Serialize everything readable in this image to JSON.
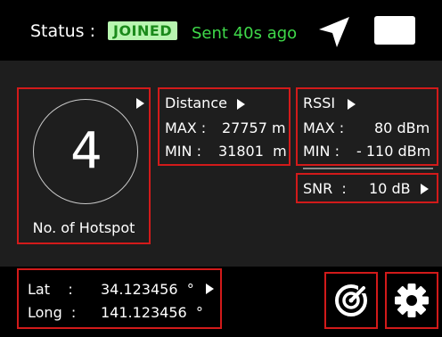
{
  "header": {
    "status_label": "Status :",
    "status_badge": "JOINED",
    "sent_text": "Sent 40s ago",
    "icons": [
      "navigation-arrow-icon",
      "battery-icon"
    ]
  },
  "hotspot": {
    "count": "4",
    "label": "No. of Hotspot"
  },
  "distance": {
    "title": "Distance",
    "max_label": "MAX :",
    "max_value": "27757 m",
    "min_label": "MIN : ",
    "min_value": "31801  m"
  },
  "rssi": {
    "title": "RSSI",
    "max_label": "MAX :",
    "max_value": "80 dBm",
    "min_label": "MIN :",
    "min_value": "- 110 dBm"
  },
  "snr": {
    "label": "SNR  :",
    "value": "10 dB"
  },
  "location": {
    "lat_label": "Lat    :",
    "lat_value": "34.123456  °",
    "long_label": "Long  :",
    "long_value": "141.123456  °"
  },
  "colors": {
    "highlight_border": "#d21a1a",
    "joined_bg": "#b8f5b0",
    "joined_text": "#1b8a1b",
    "sent_text": "#3fd94a"
  }
}
